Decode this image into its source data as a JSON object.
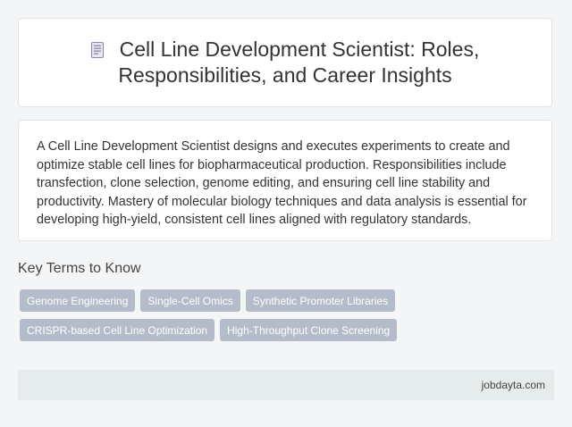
{
  "header": {
    "icon": "document-icon",
    "title": "Cell Line Development Scientist: Roles, Responsibilities, and Career Insights"
  },
  "summary": {
    "text": "A Cell Line Development Scientist designs and executes experiments to create and optimize stable cell lines for biopharmaceutical production. Responsibilities include transfection, clone selection, genome editing, and ensuring cell line stability and productivity. Mastery of molecular biology techniques and data analysis is essential for developing high-yield, consistent cell lines aligned with regulatory standards."
  },
  "key_terms": {
    "heading": "Key Terms to Know",
    "tags": [
      "Genome Engineering",
      "Single-Cell Omics",
      "Synthetic Promoter Libraries",
      "CRISPR-based Cell Line Optimization",
      "High-Throughput Clone Screening"
    ]
  },
  "footer": {
    "site": "jobdayta.com"
  },
  "colors": {
    "background": "#f4f5f7",
    "card": "#ffffff",
    "tag": "#b4bccb",
    "footer": "#e6ebec"
  }
}
